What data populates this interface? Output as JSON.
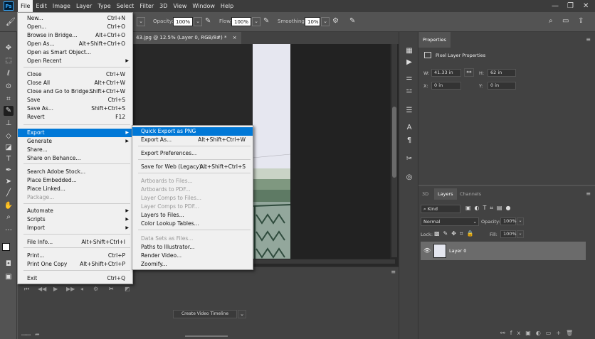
{
  "app": {
    "logo": "Ps"
  },
  "menubar": [
    "File",
    "Edit",
    "Image",
    "Layer",
    "Type",
    "Select",
    "Filter",
    "3D",
    "View",
    "Window",
    "Help"
  ],
  "options": {
    "opacity_label": "Opacity:",
    "opacity_value": "100%",
    "flow_label": "Flow:",
    "flow_value": "100%",
    "smoothing_label": "Smoothing:",
    "smoothing_value": "10%"
  },
  "document": {
    "tab_title": "43.jpg @ 12.5% (Layer 0, RGB/8#) *",
    "tab_close": "×"
  },
  "file_menu": [
    {
      "label": "New...",
      "shortcut": "Ctrl+N"
    },
    {
      "label": "Open...",
      "shortcut": "Ctrl+O"
    },
    {
      "label": "Browse in Bridge...",
      "shortcut": "Alt+Ctrl+O"
    },
    {
      "label": "Open As...",
      "shortcut": "Alt+Shift+Ctrl+O"
    },
    {
      "label": "Open as Smart Object...",
      "shortcut": ""
    },
    {
      "label": "Open Recent",
      "shortcut": "",
      "submenu": true
    },
    {
      "label": "Close",
      "shortcut": "Ctrl+W"
    },
    {
      "label": "Close All",
      "shortcut": "Alt+Ctrl+W"
    },
    {
      "label": "Close and Go to Bridge...",
      "shortcut": "Shift+Ctrl+W"
    },
    {
      "label": "Save",
      "shortcut": "Ctrl+S"
    },
    {
      "label": "Save As...",
      "shortcut": "Shift+Ctrl+S"
    },
    {
      "label": "Revert",
      "shortcut": "F12"
    },
    {
      "label": "Export",
      "shortcut": "",
      "submenu": true,
      "highlighted": true
    },
    {
      "label": "Generate",
      "shortcut": "",
      "submenu": true
    },
    {
      "label": "Share...",
      "shortcut": ""
    },
    {
      "label": "Share on Behance...",
      "shortcut": ""
    },
    {
      "label": "Search Adobe Stock...",
      "shortcut": ""
    },
    {
      "label": "Place Embedded...",
      "shortcut": ""
    },
    {
      "label": "Place Linked...",
      "shortcut": ""
    },
    {
      "label": "Package...",
      "shortcut": "",
      "disabled": true
    },
    {
      "label": "Automate",
      "shortcut": "",
      "submenu": true
    },
    {
      "label": "Scripts",
      "shortcut": "",
      "submenu": true
    },
    {
      "label": "Import",
      "shortcut": "",
      "submenu": true
    },
    {
      "label": "File Info...",
      "shortcut": "Alt+Shift+Ctrl+I"
    },
    {
      "label": "Print...",
      "shortcut": "Ctrl+P"
    },
    {
      "label": "Print One Copy",
      "shortcut": "Alt+Shift+Ctrl+P"
    },
    {
      "label": "Exit",
      "shortcut": "Ctrl+Q"
    }
  ],
  "export_menu": [
    {
      "label": "Quick Export as PNG",
      "shortcut": "",
      "highlighted": true
    },
    {
      "label": "Export As...",
      "shortcut": "Alt+Shift+Ctrl+W"
    },
    {
      "label": "Export Preferences...",
      "shortcut": ""
    },
    {
      "label": "Save for Web (Legacy)...",
      "shortcut": "Alt+Shift+Ctrl+S"
    },
    {
      "label": "Artboards to Files...",
      "shortcut": "",
      "disabled": true
    },
    {
      "label": "Artboards to PDF...",
      "shortcut": "",
      "disabled": true
    },
    {
      "label": "Layer Comps to Files...",
      "shortcut": "",
      "disabled": true
    },
    {
      "label": "Layer Comps to PDF...",
      "shortcut": "",
      "disabled": true
    },
    {
      "label": "Layers to Files...",
      "shortcut": ""
    },
    {
      "label": "Color Lookup Tables...",
      "shortcut": ""
    },
    {
      "label": "Data Sets as Files...",
      "shortcut": "",
      "disabled": true
    },
    {
      "label": "Paths to Illustrator...",
      "shortcut": ""
    },
    {
      "label": "Render Video...",
      "shortcut": ""
    },
    {
      "label": "Zoomify...",
      "shortcut": ""
    }
  ],
  "timeline": {
    "create_button": "Create Video Timeline"
  },
  "properties": {
    "tab": "Properties",
    "title": "Pixel Layer Properties",
    "w_label": "W:",
    "w_value": "41.33 in",
    "h_label": "H:",
    "h_value": "62 in",
    "x_label": "X:",
    "x_value": "0 in",
    "y_label": "Y:",
    "y_value": "0 in"
  },
  "layers": {
    "tabs": [
      "3D",
      "Layers",
      "Channels"
    ],
    "kind_label": "Kind",
    "blend_mode": "Normal",
    "opacity_label": "Opacity:",
    "opacity_value": "100%",
    "lock_label": "Lock:",
    "fill_label": "Fill:",
    "fill_value": "100%",
    "layer_name": "Layer 0"
  }
}
